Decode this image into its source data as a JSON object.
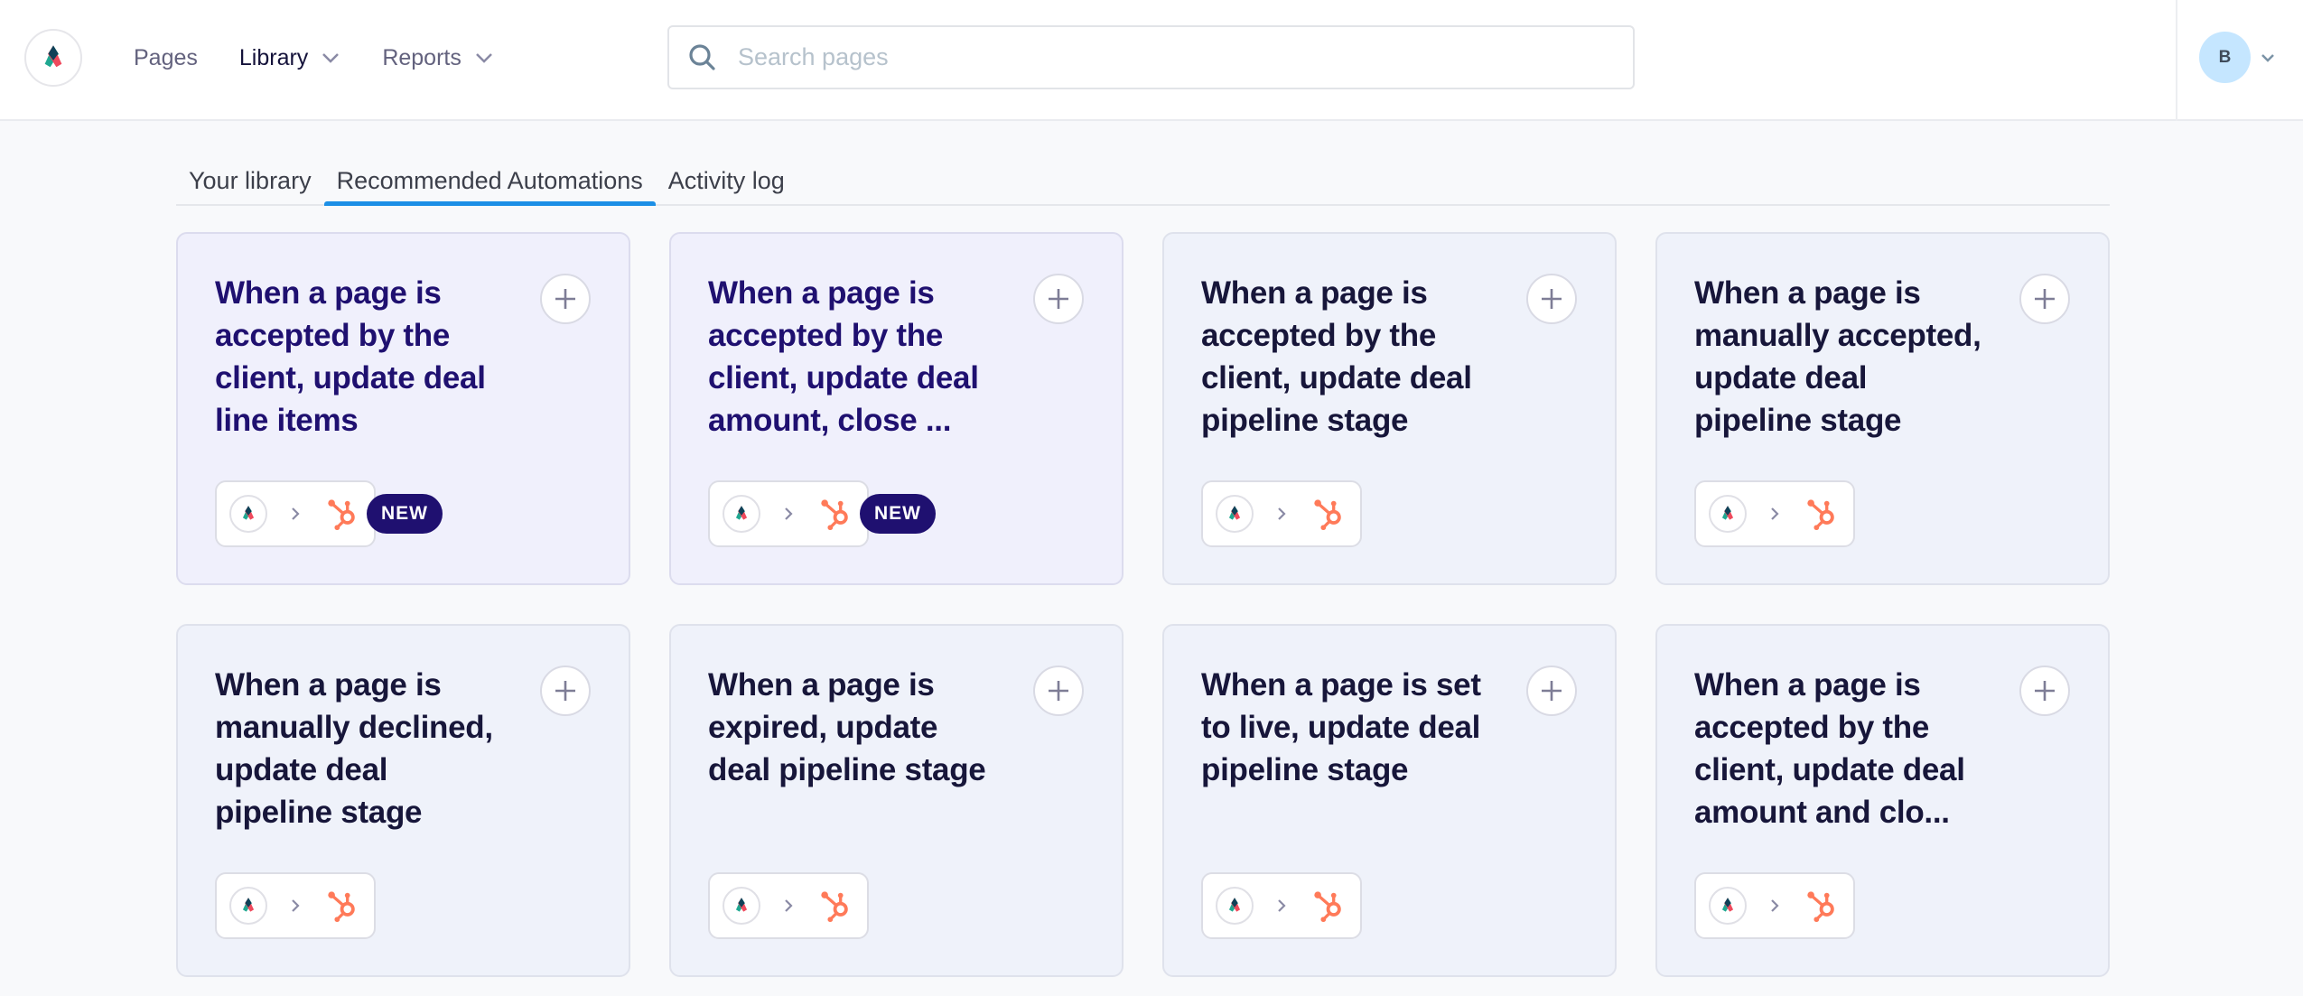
{
  "header": {
    "logo_icon": "app-logo-icon",
    "nav": [
      {
        "label": "Pages",
        "has_dropdown": false,
        "active": false
      },
      {
        "label": "Library",
        "has_dropdown": true,
        "active": true
      },
      {
        "label": "Reports",
        "has_dropdown": true,
        "active": false
      }
    ],
    "search": {
      "placeholder": "Search pages",
      "value": "",
      "icon": "search-icon"
    },
    "user": {
      "initial": "B",
      "icon": "chevron-down-icon"
    }
  },
  "tabs": [
    {
      "label": "Your library",
      "active": false
    },
    {
      "label": "Recommended Automations",
      "active": true
    },
    {
      "label": "Activity log",
      "active": false
    }
  ],
  "colors": {
    "accent_tab_underline": "#1c8fe6",
    "new_badge": "#1f1070",
    "hubspot_orange": "#ff7a59",
    "avatar_bg": "#c5e6ff"
  },
  "automations": [
    {
      "title": "When a page is accepted by the client, update deal line items",
      "source": "app-logo",
      "target": "hubspot",
      "badge": "NEW",
      "is_new": true
    },
    {
      "title": "When a page is accepted by the client, update deal amount, close ...",
      "source": "app-logo",
      "target": "hubspot",
      "badge": "NEW",
      "is_new": true
    },
    {
      "title": "When a page is accepted by the client, update deal pipeline stage",
      "source": "app-logo",
      "target": "hubspot",
      "badge": null,
      "is_new": false
    },
    {
      "title": "When a page is manually accepted, update deal pipeline stage",
      "source": "app-logo",
      "target": "hubspot",
      "badge": null,
      "is_new": false
    },
    {
      "title": "When a page is manually declined, update deal pipeline stage",
      "source": "app-logo",
      "target": "hubspot",
      "badge": null,
      "is_new": false
    },
    {
      "title": "When a page is expired, update deal pipeline stage",
      "source": "app-logo",
      "target": "hubspot",
      "badge": null,
      "is_new": false
    },
    {
      "title": "When a page is set to live, update deal pipeline stage",
      "source": "app-logo",
      "target": "hubspot",
      "badge": null,
      "is_new": false
    },
    {
      "title": "When a page is accepted by the client, update deal amount and clo...",
      "source": "app-logo",
      "target": "hubspot",
      "badge": null,
      "is_new": false
    }
  ]
}
